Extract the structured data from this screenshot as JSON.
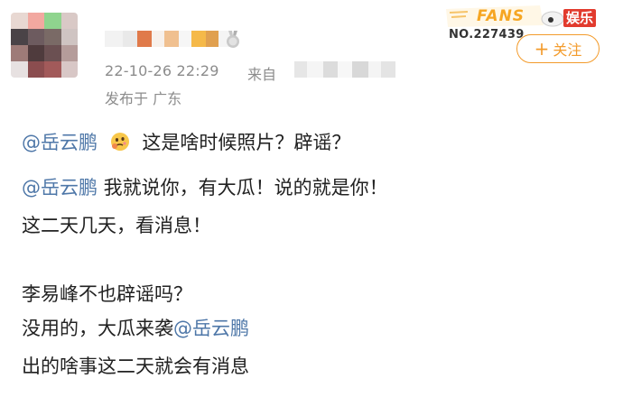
{
  "post": {
    "timestamp": "22-10-26 22:29",
    "from_label": "来自",
    "location": "发布于 广东"
  },
  "badge": {
    "fans_label": "FANS",
    "fans_number": "NO.227439",
    "follow_label": "关注",
    "watermark": "娱乐"
  },
  "content": {
    "line1": {
      "mention": "@岳云鹏",
      "text": "这是啥时候照片？辟谣？"
    },
    "line2": {
      "mention": "@岳云鹏",
      "text": " 我就说你，有大瓜！说的就是你！"
    },
    "line3": "这二天几天，看消息！",
    "line4": "李易峰不也辟谣吗？",
    "line5": {
      "text": "没用的，大瓜来袭",
      "mention": "@岳云鹏"
    },
    "line6": "出的啥事这二天就会有消息"
  },
  "colors": {
    "mention": "#4e77a8",
    "meta": "#8c8c8c",
    "accent": "#f39b2b"
  },
  "icons": {
    "medal": "medal-icon",
    "emoji": "thinking-face-icon",
    "plus": "plus-icon"
  }
}
